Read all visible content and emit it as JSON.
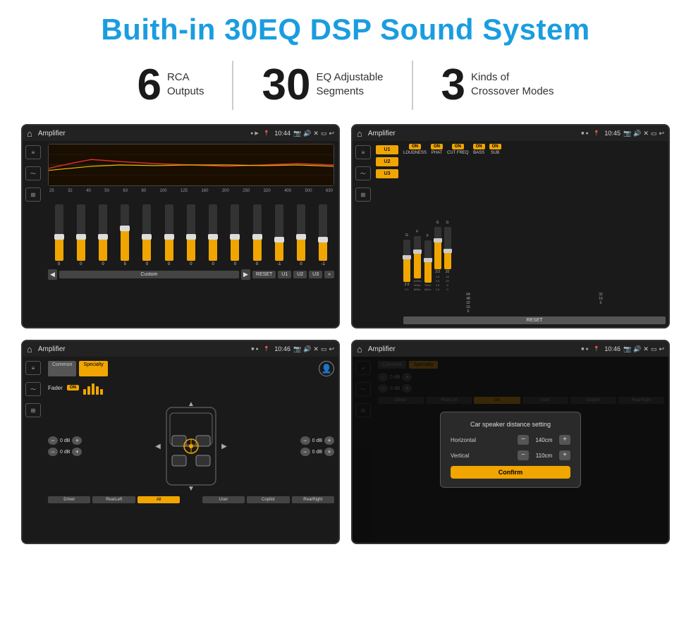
{
  "page": {
    "title": "Buith-in 30EQ DSP Sound System",
    "stats": [
      {
        "number": "6",
        "text": "RCA\nOutputs"
      },
      {
        "number": "30",
        "text": "EQ Adjustable\nSegments"
      },
      {
        "number": "3",
        "text": "Kinds of\nCrossover Modes"
      }
    ],
    "screens": [
      {
        "id": "eq-screen",
        "statusBar": {
          "home": "⌂",
          "title": "Amplifier",
          "time": "10:44",
          "icons": [
            "📷",
            "🔊",
            "✕",
            "🔋",
            "↩"
          ]
        },
        "eqLabels": [
          "25",
          "32",
          "40",
          "50",
          "63",
          "80",
          "100",
          "125",
          "160",
          "200",
          "250",
          "320",
          "400",
          "500",
          "630"
        ],
        "sliderValues": [
          0,
          0,
          0,
          5,
          0,
          0,
          0,
          0,
          0,
          0,
          -1,
          0,
          -1
        ],
        "sliderPositions": [
          40,
          40,
          40,
          50,
          40,
          40,
          40,
          40,
          40,
          40,
          35,
          40,
          35
        ],
        "bottomButtons": [
          "◀",
          "Custom",
          "▶",
          "RESET",
          "U1",
          "U2",
          "U3"
        ]
      },
      {
        "id": "amp-screen",
        "statusBar": {
          "home": "⌂",
          "title": "Amplifier",
          "time": "10:45",
          "icons": [
            "📷",
            "🔊",
            "✕",
            "🔋",
            "↩"
          ]
        },
        "presets": [
          "U1",
          "U2",
          "U3"
        ],
        "toggles": [
          {
            "label": "LOUDNESS",
            "on": true
          },
          {
            "label": "PHAT",
            "on": true
          },
          {
            "label": "CUT FREQ",
            "on": true
          },
          {
            "label": "BASS",
            "on": true
          },
          {
            "label": "SUB",
            "on": true
          }
        ],
        "resetLabel": "RESET"
      },
      {
        "id": "fader-screen",
        "statusBar": {
          "home": "⌂",
          "title": "Amplifier",
          "time": "10:46",
          "icons": [
            "📷",
            "🔊",
            "✕",
            "🔋",
            "↩"
          ]
        },
        "tabs": [
          "Common",
          "Specialty"
        ],
        "faderLabel": "Fader",
        "faderOn": "ON",
        "dbValues": [
          "0 dB",
          "0 dB",
          "0 dB",
          "0 dB"
        ],
        "bottomButtons": [
          "Driver",
          "RearLeft",
          "All",
          "User",
          "Copilot",
          "RearRight"
        ]
      },
      {
        "id": "dialog-screen",
        "statusBar": {
          "home": "⌂",
          "title": "Amplifier",
          "time": "10:46",
          "icons": [
            "📷",
            "🔊",
            "✕",
            "🔋",
            "↩"
          ]
        },
        "tabs": [
          "Common",
          "Specialty"
        ],
        "dialog": {
          "title": "Car speaker distance setting",
          "horizontal": {
            "label": "Horizontal",
            "value": "140cm"
          },
          "vertical": {
            "label": "Vertical",
            "value": "110cm"
          },
          "confirmLabel": "Confirm"
        },
        "dbValues": [
          "0 dB",
          "0 dB"
        ],
        "bottomButtons": [
          "Driver",
          "RearLeft...",
          "All",
          "User",
          "Copilot",
          "RearRight"
        ]
      }
    ]
  }
}
